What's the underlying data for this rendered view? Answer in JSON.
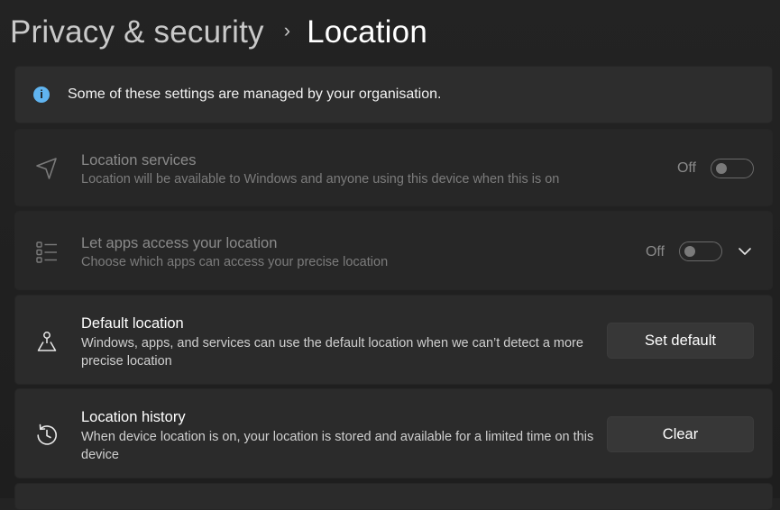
{
  "breadcrumb": {
    "parent": "Privacy & security",
    "separator": "›",
    "current": "Location"
  },
  "notice": {
    "icon": "info-icon",
    "text": "Some of these settings are managed by your organisation."
  },
  "settings": [
    {
      "icon": "location-arrow-icon",
      "title": "Location services",
      "description": "Location will be available to Windows and anyone using this device when this is on",
      "state": "Off",
      "enabled": false
    },
    {
      "icon": "app-list-icon",
      "title": "Let apps access your location",
      "description": "Choose which apps can access your precise location",
      "state": "Off",
      "enabled": false,
      "expandable": true
    },
    {
      "icon": "default-location-pin-icon",
      "title": "Default location",
      "description": "Windows, apps, and services can use the default location when we can’t detect a more precise location",
      "button": "Set default"
    },
    {
      "icon": "history-icon",
      "title": "Location history",
      "description": "When device location is on, your location is stored and available for a limited time on this device",
      "button": "Clear"
    }
  ],
  "colors": {
    "background": "#202020",
    "card": "#2b2b2b",
    "info_accent": "#60b4f0",
    "button": "#373737"
  }
}
